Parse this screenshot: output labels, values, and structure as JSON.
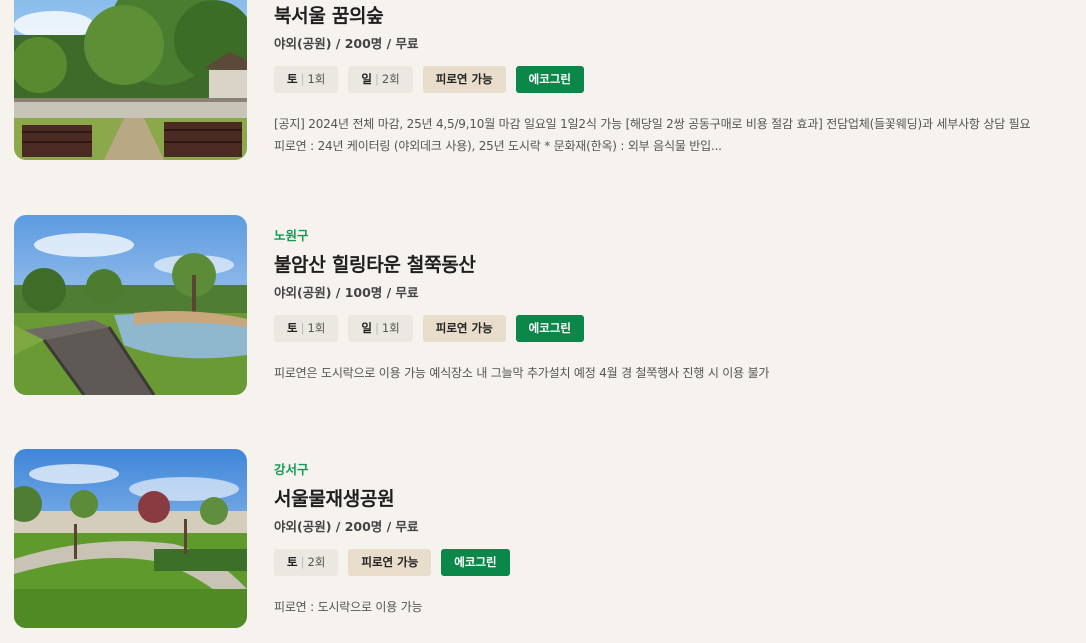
{
  "venues": [
    {
      "district": "",
      "name": "북서울 꿈의숲",
      "meta": "야외(공원) / 200명 / 무료",
      "days": [
        {
          "day": "토",
          "count": "1회"
        },
        {
          "day": "일",
          "count": "2회"
        }
      ],
      "reception_label": "피로연 가능",
      "eco_label": "에코그린",
      "description": "[공지] 2024년 전체 마감, 25년 4,5/9,10월 마감 일요일 1일2식 가능 [해당일 2쌍 공동구매로 비용 절감 효과] 전담업체(들꽃웨딩)과 세부사항 상담 필요 피로연 : 24년 케이터링 (야외데크 사용), 25년 도시락 * 문화재(한옥) : 외부 음식물 반입...",
      "image_icon": "hanok-garden-photo"
    },
    {
      "district": "노원구",
      "name": "불암산 힐링타운 철쭉동산",
      "meta": "야외(공원) / 100명 / 무료",
      "days": [
        {
          "day": "토",
          "count": "1회"
        },
        {
          "day": "일",
          "count": "1회"
        }
      ],
      "reception_label": "피로연 가능",
      "eco_label": "에코그린",
      "description": "피로연은 도시락으로 이용 가능 예식장소 내 그늘막 추가설치 예정 4월 경 철쭉행사 진행 시 이용 불가",
      "image_icon": "pond-boardwalk-photo"
    },
    {
      "district": "강서구",
      "name": "서울물재생공원",
      "meta": "야외(공원) / 200명 / 무료",
      "days": [
        {
          "day": "토",
          "count": "2회"
        }
      ],
      "reception_label": "피로연 가능",
      "eco_label": "에코그린",
      "description": "피로연 : 도시락으로 이용 가능",
      "image_icon": "park-path-photo"
    }
  ],
  "colors": {
    "background": "#f6f3ee",
    "district": "#159a56",
    "eco_tag": "#0c874a",
    "reception_tag": "#e8dccb",
    "day_tag": "#ebe7e1"
  }
}
